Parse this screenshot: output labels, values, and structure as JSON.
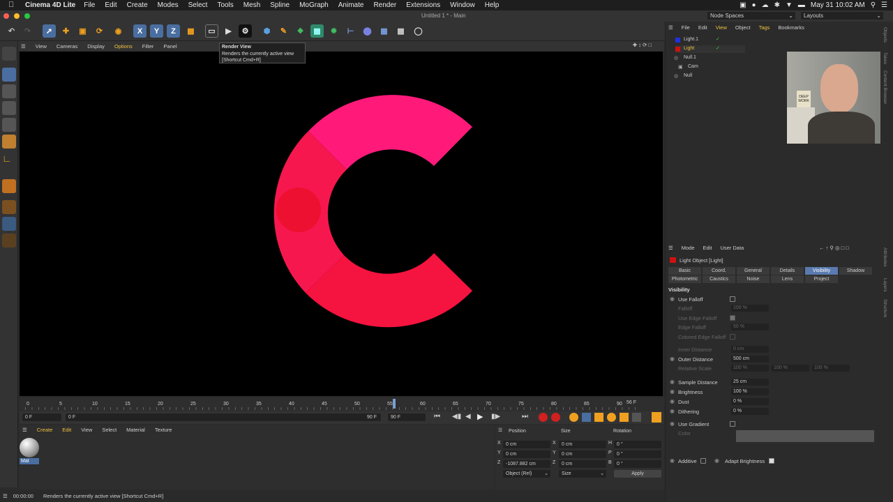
{
  "menubar": {
    "app": "Cinema 4D Lite",
    "items": [
      "File",
      "Edit",
      "Create",
      "Modes",
      "Select",
      "Tools",
      "Mesh",
      "Spline",
      "MoGraph",
      "Animate",
      "Render",
      "Extensions",
      "Window",
      "Help"
    ],
    "clock": "May 31  10:02 AM"
  },
  "window": {
    "title": "Untitled 1 * - Main",
    "node_spaces": "Node Spaces",
    "layouts": "Layouts"
  },
  "viewport": {
    "menu": [
      "View",
      "Cameras",
      "Display",
      "Options",
      "Filter",
      "Panel"
    ],
    "colors": {
      "top": "#ff1a7a",
      "left": "#f7174f",
      "bottom": "#f5133f",
      "dot": "#ee1030"
    }
  },
  "tooltip": {
    "title": "Render View",
    "line1": "Renders the currently active view",
    "line2": "[Shortcut Cmd+R]"
  },
  "timeline": {
    "ticks": [
      "0",
      "5",
      "10",
      "15",
      "20",
      "25",
      "30",
      "35",
      "40",
      "45",
      "50",
      "55",
      "60",
      "65",
      "70",
      "75",
      "80",
      "85",
      "90"
    ],
    "current": "56",
    "current_label": "56 F",
    "start": "0 F",
    "min": "0 F",
    "end": "90 F",
    "max": "90 F"
  },
  "materials": {
    "menu": [
      "Create",
      "Edit",
      "View",
      "Select",
      "Material",
      "Texture"
    ],
    "mat_label": "Mat"
  },
  "coords": {
    "headers": {
      "position": "Position",
      "size": "Size",
      "rotation": "Rotation"
    },
    "rows": [
      {
        "axis": "X",
        "pos": "0 cm",
        "saxis": "X",
        "size": "0 cm",
        "raxis": "H",
        "rot": "0 °"
      },
      {
        "axis": "Y",
        "pos": "0 cm",
        "saxis": "Y",
        "size": "0 cm",
        "raxis": "P",
        "rot": "0 °"
      },
      {
        "axis": "Z",
        "pos": "-1087.882 cm",
        "saxis": "Z",
        "size": "0 cm",
        "raxis": "B",
        "rot": "0 °"
      }
    ],
    "mode": "Object (Rel)",
    "size_mode": "Size",
    "apply": "Apply"
  },
  "status": {
    "time": "00:00:00",
    "message": "Renders the currently active view [Shortcut Cmd+R]"
  },
  "objects": {
    "menu": [
      "File",
      "Edit",
      "View",
      "Object",
      "Tags",
      "Bookmarks"
    ],
    "items": [
      "Light.1",
      "Light",
      "Null.1",
      "Cam",
      "Null"
    ]
  },
  "attributes": {
    "menu": [
      "Mode",
      "Edit",
      "User Data"
    ],
    "object_title": "Light Object [Light]",
    "tabs_row1": [
      "Basic",
      "Coord.",
      "General",
      "Details",
      "Visibility",
      "Shadow"
    ],
    "tabs_row2": [
      "Photometric",
      "Caustics",
      "Noise",
      "Lens",
      "Project"
    ],
    "section": "Visibility",
    "fields": {
      "use_falloff": "Use Falloff",
      "falloff": "Falloff",
      "falloff_val": "100 %",
      "use_edge_falloff": "Use Edge Falloff",
      "edge_falloff": "Edge Falloff",
      "edge_falloff_val": "50 %",
      "colored_edge": "Colored Edge Falloff",
      "inner": "Inner Distance",
      "inner_val": "0 cm",
      "outer": "Outer Distance",
      "outer_val": "500 cm",
      "relative": "Relative Scale",
      "rel_v1": "100 %",
      "rel_v2": "100 %",
      "rel_v3": "100 %",
      "sample": "Sample Distance",
      "sample_val": "25 cm",
      "brightness": "Brightness",
      "brightness_val": "100 %",
      "dust": "Dust",
      "dust_val": "0 %",
      "dithering": "Dithering",
      "dithering_val": "0 %",
      "use_gradient": "Use Gradient",
      "color": "Color",
      "additive": "Additive",
      "adapt": "Adapt Brightness"
    },
    "side_tabs": [
      "Objects",
      "Takes",
      "Content Browser",
      "Attributes",
      "Layers",
      "Structure"
    ]
  },
  "webcam": {
    "mug_text": "DEEP WORK"
  }
}
